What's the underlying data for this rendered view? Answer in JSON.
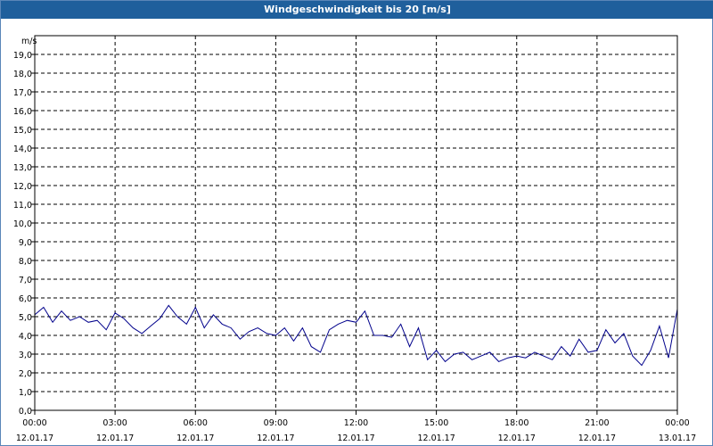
{
  "window": {
    "title": "Windgeschwindigkeit bis 20 [m/s]"
  },
  "colors": {
    "titlebar": "#1f5f9c",
    "line": "#00008b",
    "grid": "#000000"
  },
  "chart_data": {
    "type": "line",
    "title": "Windgeschwindigkeit bis 20 [m/s]",
    "ylabel": "m/s",
    "ylim": [
      0,
      20
    ],
    "xlim_hours": [
      0,
      24
    ],
    "grid": true,
    "y_ticks": [
      "0,0",
      "1,0",
      "2,0",
      "3,0",
      "4,0",
      "5,0",
      "6,0",
      "7,0",
      "8,0",
      "9,0",
      "10,0",
      "11,0",
      "12,0",
      "13,0",
      "14,0",
      "15,0",
      "16,0",
      "17,0",
      "18,0",
      "19,0"
    ],
    "x_ticks": [
      {
        "time": "00:00",
        "date": "12.01.17"
      },
      {
        "time": "03:00",
        "date": "12.01.17"
      },
      {
        "time": "06:00",
        "date": "12.01.17"
      },
      {
        "time": "09:00",
        "date": "12.01.17"
      },
      {
        "time": "12:00",
        "date": "12.01.17"
      },
      {
        "time": "15:00",
        "date": "12.01.17"
      },
      {
        "time": "18:00",
        "date": "12.01.17"
      },
      {
        "time": "21:00",
        "date": "12.01.17"
      },
      {
        "time": "00:00",
        "date": "13.01.17"
      }
    ],
    "series": [
      {
        "hours": [
          0,
          0.33,
          0.67,
          1,
          1.33,
          1.67,
          2,
          2.33,
          2.67,
          3,
          3.33,
          3.67,
          4,
          4.33,
          4.67,
          5,
          5.33,
          5.67,
          6,
          6.33,
          6.67,
          7,
          7.33,
          7.67,
          8,
          8.33,
          8.67,
          9,
          9.33,
          9.67,
          10,
          10.33,
          10.67,
          11,
          11.33,
          11.67,
          12,
          12.33,
          12.67,
          13,
          13.33,
          13.67,
          14,
          14.33,
          14.67,
          15,
          15.33,
          15.67,
          16,
          16.33,
          16.67,
          17,
          17.33,
          17.67,
          18,
          18.33,
          18.67,
          19,
          19.33,
          19.67,
          20,
          20.33,
          20.67,
          21,
          21.33,
          21.67,
          22,
          22.33,
          22.67,
          23,
          23.33,
          23.67,
          24
        ],
        "values": [
          5.1,
          5.5,
          4.7,
          5.3,
          4.8,
          5.0,
          4.7,
          4.8,
          4.3,
          5.2,
          4.9,
          4.4,
          4.1,
          4.5,
          4.9,
          5.6,
          5.0,
          4.6,
          5.5,
          4.4,
          5.1,
          4.6,
          4.4,
          3.8,
          4.2,
          4.4,
          4.1,
          4.0,
          4.4,
          3.7,
          4.4,
          3.4,
          3.1,
          4.3,
          4.6,
          4.8,
          4.7,
          5.3,
          4.0,
          4.0,
          3.9,
          4.6,
          3.4,
          4.4,
          2.7,
          3.2,
          2.6,
          3.0,
          3.1,
          2.7,
          2.9,
          3.1,
          2.6,
          2.8,
          2.9,
          2.8,
          3.1,
          2.9,
          2.7,
          3.4,
          2.9,
          3.8,
          3.1,
          3.2,
          4.3,
          3.6,
          4.1,
          2.9,
          2.4,
          3.2,
          4.5,
          2.8,
          5.4
        ]
      }
    ]
  }
}
